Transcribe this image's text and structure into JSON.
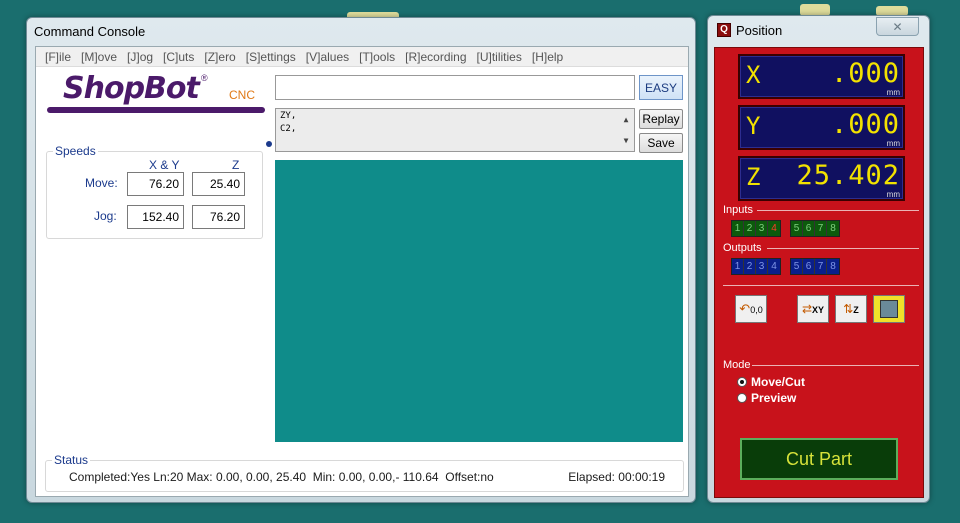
{
  "console": {
    "title": "Command Console",
    "menu": [
      "[F]ile",
      "[M]ove",
      "[J]og",
      "[C]uts",
      "[Z]ero",
      "[S]ettings",
      "[V]alues",
      "[T]ools",
      "[R]ecording",
      "[U]tilities",
      "[H]elp"
    ],
    "logo": {
      "text": "ShopBot",
      "reg": "®",
      "suffix": "CNC"
    },
    "speeds": {
      "title": "Speeds",
      "col_xy": "X & Y",
      "col_z": "Z",
      "move_label": "Move:",
      "jog_label": "Jog:",
      "move_xy": "76.20",
      "move_z": "25.40",
      "jog_xy": "152.40",
      "jog_z": "76.20"
    },
    "command_value": "",
    "easy_label": "EASY",
    "history": [
      "ZY,",
      "C2,"
    ],
    "replay_label": "Replay",
    "save_label": "Save",
    "status": {
      "title": "Status",
      "text": "Completed:Yes Ln:20 Max: 0.00, 0.00, 25.40  Min: 0.00, 0.00,- 110.64  Offset:no",
      "elapsed": "Elapsed: 00:00:19"
    }
  },
  "position": {
    "title": "Position",
    "icon_letter": "Q",
    "close_label": "✕",
    "axes": [
      {
        "letter": "X",
        "value": ".000",
        "unit": "mm"
      },
      {
        "letter": "Y",
        "value": ".000",
        "unit": "mm"
      },
      {
        "letter": "Z",
        "value": "25.402",
        "unit": "mm"
      }
    ],
    "inputs_label": "Inputs",
    "outputs_label": "Outputs",
    "io_numbers_a": [
      "1",
      "2",
      "3",
      "4"
    ],
    "io_numbers_b": [
      "5",
      "6",
      "7",
      "8"
    ],
    "tools": {
      "zero_label": "0,0",
      "xy_label": "XY",
      "z_label": "Z"
    },
    "mode_label": "Mode",
    "mode_options": [
      "Move/Cut",
      "Preview"
    ],
    "mode_selected": "Move/Cut",
    "cutpart_label": "Cut Part"
  },
  "colors": {
    "desktop": "#1a6e6e",
    "preview": "#0f8c8a",
    "position_panel": "#c8121b",
    "readout_bg": "#101060",
    "readout_text": "#f2e200",
    "logo": "#4b1a6a"
  }
}
